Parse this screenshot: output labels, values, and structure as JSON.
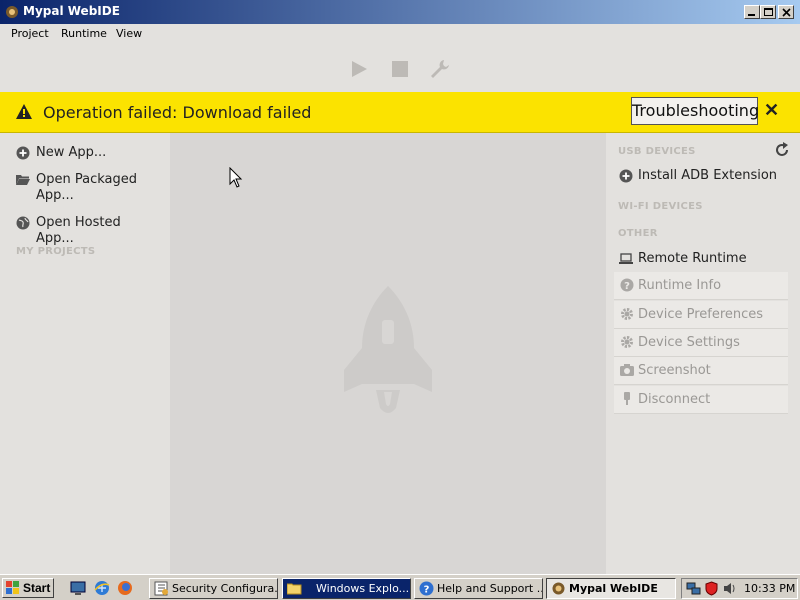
{
  "window": {
    "title": "Mypal WebIDE"
  },
  "menu": [
    {
      "label": "Project"
    },
    {
      "label": "Runtime"
    },
    {
      "label": "View"
    }
  ],
  "toolbar": {
    "icons": [
      "play-icon",
      "stop-icon",
      "wrench-icon"
    ]
  },
  "notification": {
    "message": "Operation failed: Download failed",
    "button_label": "Troubleshooting",
    "close_label": "✕",
    "color": "#fbe300"
  },
  "left": {
    "items": [
      {
        "label": "New App...",
        "icon": "plus-circle-icon"
      },
      {
        "label": "Open Packaged App...",
        "icon": "folder-open-icon"
      },
      {
        "label": "Open Hosted App...",
        "icon": "globe-icon"
      }
    ],
    "section_my_projects": "MY PROJECTS"
  },
  "right": {
    "usb_devices": "USB DEVICES",
    "install_adb": "Install ADB Extension",
    "wifi_devices": "WI-FI DEVICES",
    "other": "OTHER",
    "remote_runtime": "Remote Runtime",
    "runtime_actions": [
      {
        "label": "Runtime Info",
        "icon": "question-circle-icon"
      },
      {
        "label": "Device Preferences",
        "icon": "gear-icon"
      },
      {
        "label": "Device Settings",
        "icon": "gear-icon"
      },
      {
        "label": "Screenshot",
        "icon": "camera-icon"
      },
      {
        "label": "Disconnect",
        "icon": "plug-icon"
      }
    ]
  },
  "taskbar": {
    "start_label": "Start",
    "tasks": [
      {
        "label": "Security Configura..."
      },
      {
        "label": "Windows Explo..."
      },
      {
        "label": "Help and Support ..."
      },
      {
        "label": "Mypal WebIDE"
      }
    ],
    "clock": "10:33 PM"
  }
}
